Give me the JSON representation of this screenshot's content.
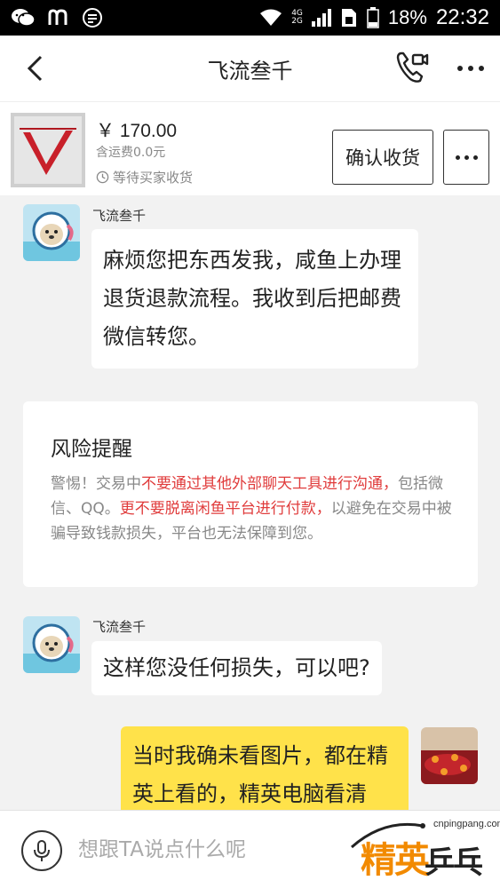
{
  "status_bar": {
    "network_top": "4G",
    "network_bottom": "2G",
    "battery": "18%",
    "time": "22:32"
  },
  "header": {
    "title": "飞流叁千"
  },
  "product": {
    "price": "￥ 170.00",
    "shipping": "含运费0.0元",
    "status": "等待买家收货",
    "confirm_label": "确认收货"
  },
  "messages": [
    {
      "sender": "飞流叁千",
      "text": "麻烦您把东西发我，咸鱼上办理退货退款流程。我收到后把邮费微信转您。"
    },
    {
      "sender": "飞流叁千",
      "text": "这样您没任何损失，可以吧?"
    },
    {
      "sender": "me",
      "text": "当时我确未看图片，都在精英上看的，精英电脑看清"
    }
  ],
  "risk": {
    "title": "风险提醒",
    "seg1": "警惕！交易中",
    "seg2": "不要通过其他外部聊天工具进行沟通，",
    "seg3": "包括微信、QQ。",
    "seg4": "更不要脱离闲鱼平台进行付款，",
    "seg5": "以避免在交易中被骗导致钱款损失，平台也无法保障到您。"
  },
  "input": {
    "placeholder": "想跟TA说点什么呢"
  },
  "watermark": {
    "url": "cnpingpang.com",
    "brand1": "精英",
    "brand2": "乒乓网"
  },
  "colors": {
    "warning": "#e03c3c",
    "my_bubble": "#ffe24a",
    "watermark_orange": "#f28a00"
  }
}
